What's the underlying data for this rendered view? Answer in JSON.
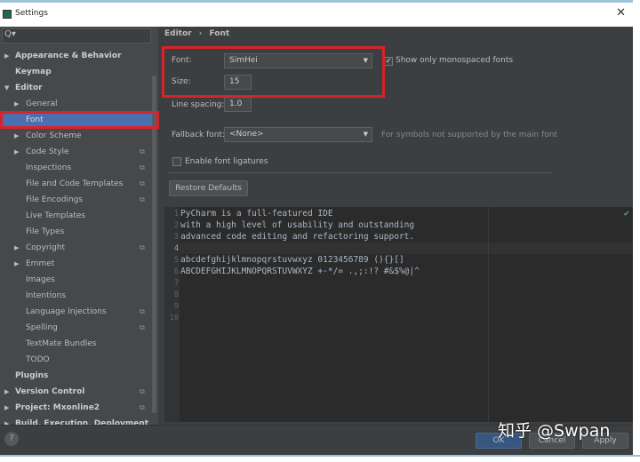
{
  "window": {
    "title": "Settings",
    "close": "✕"
  },
  "search": {
    "icon": "search-icon",
    "value": "Q▾"
  },
  "sidebar": {
    "items": [
      {
        "label": "Appearance & Behavior",
        "level": 0,
        "arrow": "▶",
        "bold": true
      },
      {
        "label": "Keymap",
        "level": 0,
        "bold": true
      },
      {
        "label": "Editor",
        "level": 0,
        "arrow": "▼",
        "bold": true
      },
      {
        "label": "General",
        "level": 1,
        "arrow": "▶"
      },
      {
        "label": "Font",
        "level": 1,
        "selected": true
      },
      {
        "label": "Color Scheme",
        "level": 1,
        "arrow": "▶"
      },
      {
        "label": "Code Style",
        "level": 1,
        "arrow": "▶",
        "copy": true
      },
      {
        "label": "Inspections",
        "level": 1,
        "copy": true
      },
      {
        "label": "File and Code Templates",
        "level": 1,
        "copy": true
      },
      {
        "label": "File Encodings",
        "level": 1,
        "copy": true
      },
      {
        "label": "Live Templates",
        "level": 1
      },
      {
        "label": "File Types",
        "level": 1
      },
      {
        "label": "Copyright",
        "level": 1,
        "arrow": "▶",
        "copy": true
      },
      {
        "label": "Emmet",
        "level": 1,
        "arrow": "▶"
      },
      {
        "label": "Images",
        "level": 1
      },
      {
        "label": "Intentions",
        "level": 1
      },
      {
        "label": "Language Injections",
        "level": 1,
        "copy": true
      },
      {
        "label": "Spelling",
        "level": 1,
        "copy": true
      },
      {
        "label": "TextMate Bundles",
        "level": 1
      },
      {
        "label": "TODO",
        "level": 1
      },
      {
        "label": "Plugins",
        "level": 0,
        "bold": true
      },
      {
        "label": "Version Control",
        "level": 0,
        "arrow": "▶",
        "bold": true,
        "copy": true
      },
      {
        "label": "Project: Mxonline2",
        "level": 0,
        "arrow": "▶",
        "bold": true,
        "copy": true
      },
      {
        "label": "Build, Execution, Deployment",
        "level": 0,
        "arrow": "▶",
        "bold": true
      }
    ]
  },
  "breadcrumb": {
    "parent": "Editor",
    "sep": "›",
    "current": "Font"
  },
  "font": {
    "label": "Font:",
    "value": "SimHei",
    "mono_label": "Show only monospaced fonts",
    "mono_checked": true
  },
  "size": {
    "label": "Size:",
    "value": "15"
  },
  "line_spacing": {
    "label": "Line spacing:",
    "value": "1.0"
  },
  "fallback": {
    "label": "Fallback font:",
    "value": "<None>",
    "hint": "For symbols not supported by the main font"
  },
  "ligatures": {
    "label": "Enable font ligatures",
    "checked": false
  },
  "restore_label": "Restore Defaults",
  "preview": {
    "lines": [
      "PyCharm is a full-featured IDE",
      "with a high level of usability and outstanding",
      "advanced code editing and refactoring support.",
      "",
      "abcdefghijklmnopqrstuvwxyz 0123456789 (){}[]",
      "ABCDEFGHIJKLMNOPQRSTUVWXYZ +-*/= .,;:!? #&$%@|^",
      "",
      "",
      "",
      ""
    ]
  },
  "buttons": {
    "ok": "OK",
    "cancel": "Cancel",
    "apply": "Apply",
    "help": "?"
  },
  "watermark": "知乎 @Swpan",
  "colors": {
    "selection": "#4b6eaf",
    "highlight": "#d8232a",
    "editor_bg": "#2b2b2b"
  }
}
